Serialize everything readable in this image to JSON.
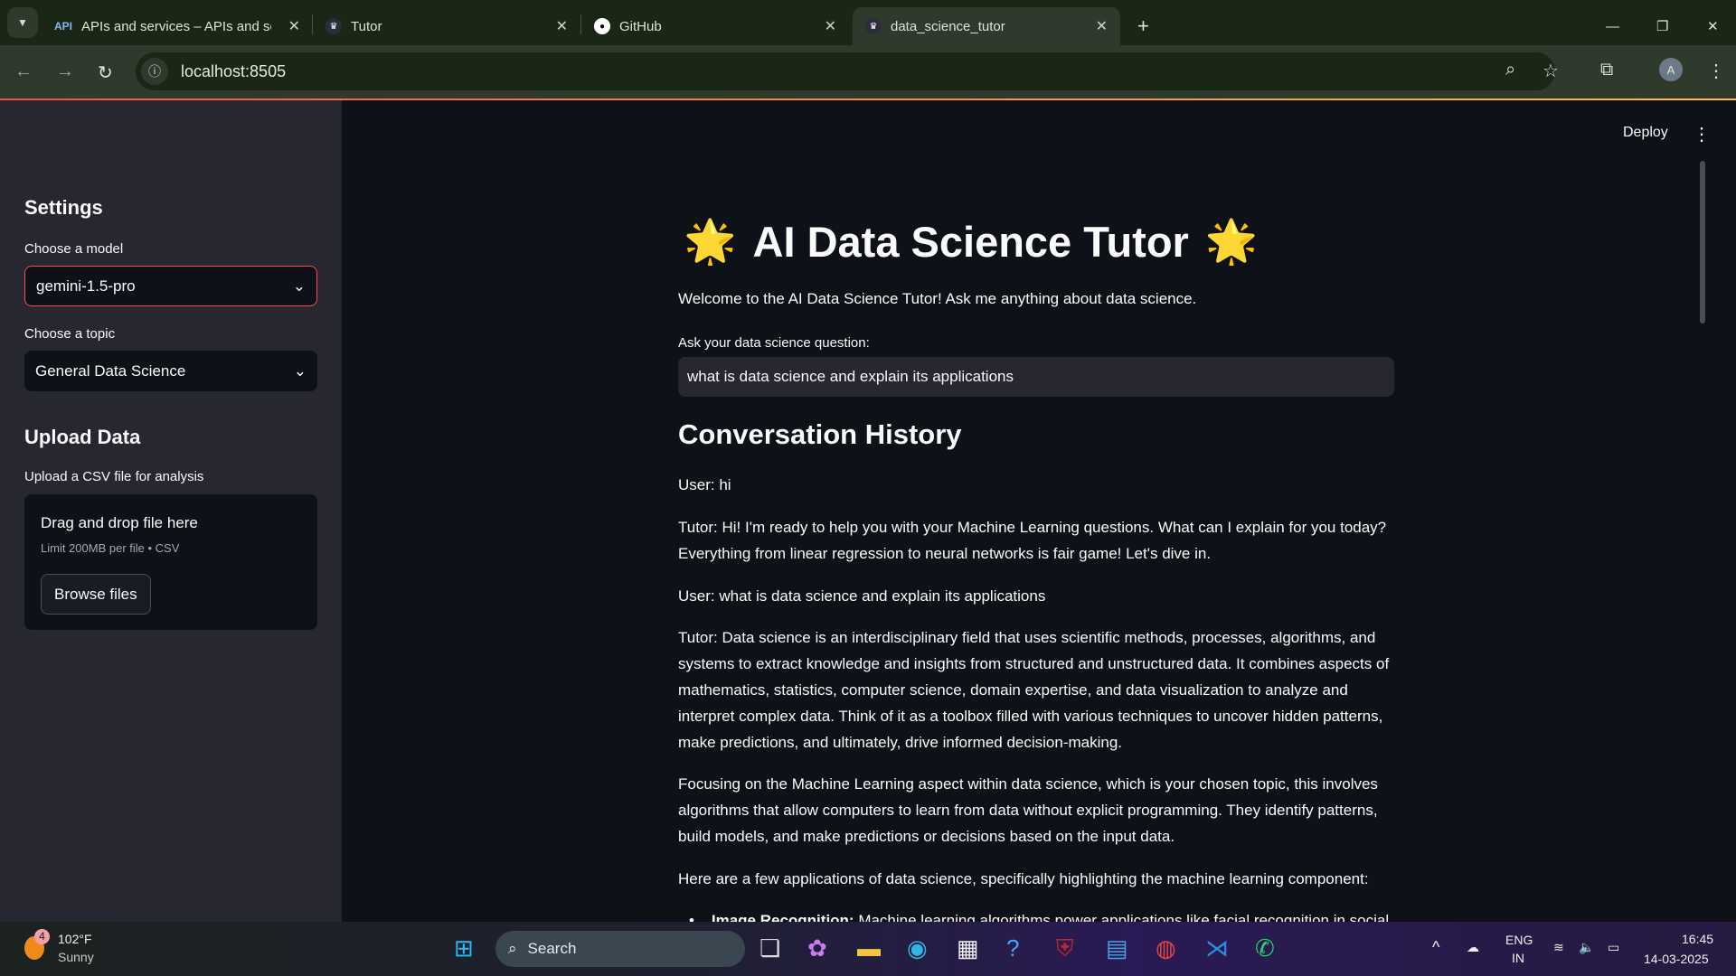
{
  "browser": {
    "tabs": [
      {
        "label": "APIs and services – APIs and ser",
        "icon": "api-icon",
        "icon_text": "API"
      },
      {
        "label": "Tutor",
        "icon": "streamlit-crown-icon"
      },
      {
        "label": "GitHub",
        "icon": "github-icon"
      },
      {
        "label": "data_science_tutor",
        "icon": "streamlit-crown-icon",
        "active": true
      }
    ],
    "url": "localhost:8505",
    "profile_initial": "A"
  },
  "sidebar": {
    "settings_heading": "Settings",
    "model_label": "Choose a model",
    "model_value": "gemini-1.5-pro",
    "topic_label": "Choose a topic",
    "topic_value": "General Data Science",
    "upload_heading": "Upload Data",
    "upload_label": "Upload a CSV file for analysis",
    "drop_text": "Drag and drop file here",
    "drop_limit": "Limit 200MB per file • CSV",
    "browse_label": "Browse files"
  },
  "header": {
    "deploy_label": "Deploy"
  },
  "main": {
    "title": "AI Data Science Tutor",
    "title_emoji": "🌟",
    "welcome": "Welcome to the AI Data Science Tutor! Ask me anything about data science.",
    "question_label": "Ask your data science question:",
    "question_value": "what is data science and explain its applications",
    "history_heading": "Conversation History",
    "messages": [
      "User: hi",
      "Tutor: Hi! I'm ready to help you with your Machine Learning questions. What can I explain for you today? Everything from linear regression to neural networks is fair game! Let's dive in.",
      "User: what is data science and explain its applications",
      "Tutor: Data science is an interdisciplinary field that uses scientific methods, processes, algorithms, and systems to extract knowledge and insights from structured and unstructured data. It combines aspects of mathematics, statistics, computer science, domain expertise, and data visualization to analyze and interpret complex data. Think of it as a toolbox filled with various techniques to uncover hidden patterns, make predictions, and ultimately, drive informed decision-making.",
      "Focusing on the Machine Learning aspect within data science, which is your chosen topic, this involves algorithms that allow computers to learn from data without explicit programming. They identify patterns, build models, and make predictions or decisions based on the input data.",
      "Here are a few applications of data science, specifically highlighting the machine learning component:"
    ],
    "bullet_bold": "Image Recognition:",
    "bullet_text": " Machine learning algorithms power applications like facial recognition in social"
  },
  "taskbar": {
    "weather_temp": "102°F",
    "weather_cond": "Sunny",
    "weather_badge": "4",
    "search_label": "Search",
    "lang": "ENG",
    "region": "IN",
    "time": "16:45",
    "date": "14-03-2025"
  }
}
